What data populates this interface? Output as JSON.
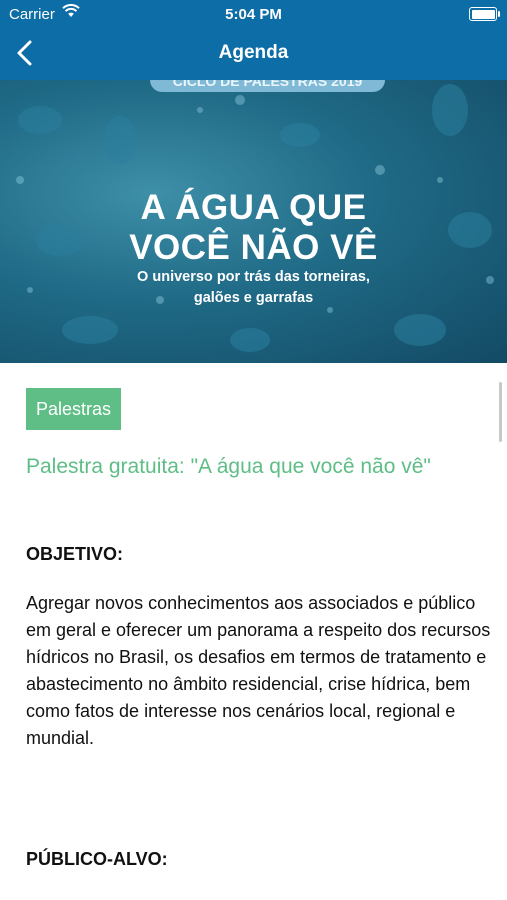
{
  "status_bar": {
    "carrier": "Carrier",
    "time": "5:04 PM"
  },
  "nav": {
    "title": "Agenda",
    "back_icon": "chevron-left-icon"
  },
  "hero": {
    "badge": "CICLO DE PALESTRAS 2019",
    "title_line1": "A ÁGUA QUE",
    "title_line2": "VOCÊ NÃO VÊ",
    "subtitle_line1": "O universo por trás das torneiras,",
    "subtitle_line2": "galões e garrafas"
  },
  "category": "Palestras",
  "event_title": "Palestra gratuita: \"A água que você não vê\"",
  "sections": {
    "objective_label": "OBJETIVO:",
    "objective_text": "Agregar novos conhecimentos aos associados e público em geral e oferecer um panorama a respeito dos recursos hídricos no Brasil, os desafios em termos de tratamento e abastecimento no âmbito residencial, crise hídrica, bem como fatos de interesse nos cenários local, regional e mundial.",
    "audience_label": "PÚBLICO-ALVO:"
  },
  "colors": {
    "header": "#0d6da6",
    "accent_green": "#5ebe86"
  }
}
